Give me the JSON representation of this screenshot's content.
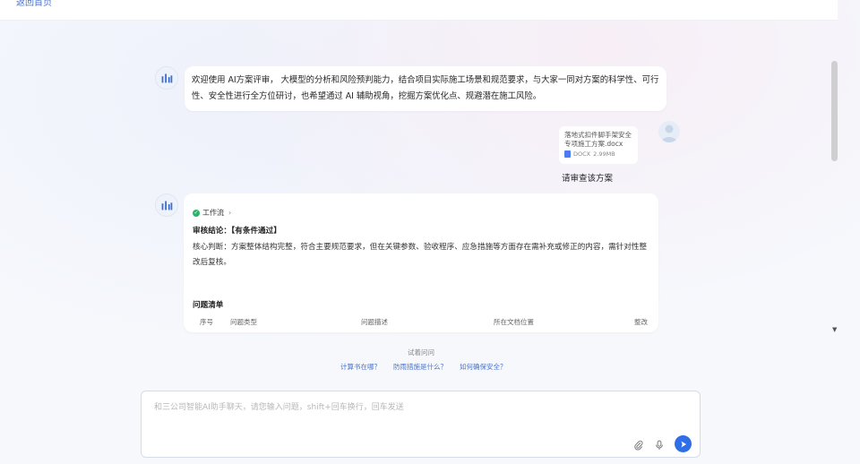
{
  "topbar": {
    "crumb": "返回首页"
  },
  "welcome": {
    "text": "欢迎使用 AI方案评审， 大模型的分析和风险预判能力，结合项目实际施工场景和规范要求，与大家一同对方案的科学性、可行性、安全性进行全方位研讨，也希望通过 AI 辅助视角，挖掘方案优化点、规避潜在施工风险。"
  },
  "file": {
    "name": "落地式扣件脚手架安全专项施工方案.docx",
    "type": "DOCX",
    "size": "2.99MB"
  },
  "user_message": "请审查该方案",
  "result": {
    "status": "工作流",
    "conclusion": "审核结论：【有条件通过】",
    "judgement": "核心判断：方案整体结构完整，符合主要规范要求，但在关键参数、验收程序、应急措施等方面存在需补充或修正的内容，需针对性整改后复核。",
    "issues_title": "问题清单",
    "columns": [
      "序号",
      "问题类型",
      "问题描述",
      "所在文档位置",
      "整改"
    ]
  },
  "suggest": {
    "title": "试着问问",
    "items": [
      "计算书在哪？",
      "防雨措施是什么？",
      "如何确保安全？"
    ]
  },
  "input": {
    "placeholder": "和三公司智能AI助手聊天，请您输入问题，shift+回车换行，回车发送"
  },
  "colors": {
    "accent": "#2f6ee6",
    "link": "#4c74c9",
    "success": "#2fb36b"
  }
}
